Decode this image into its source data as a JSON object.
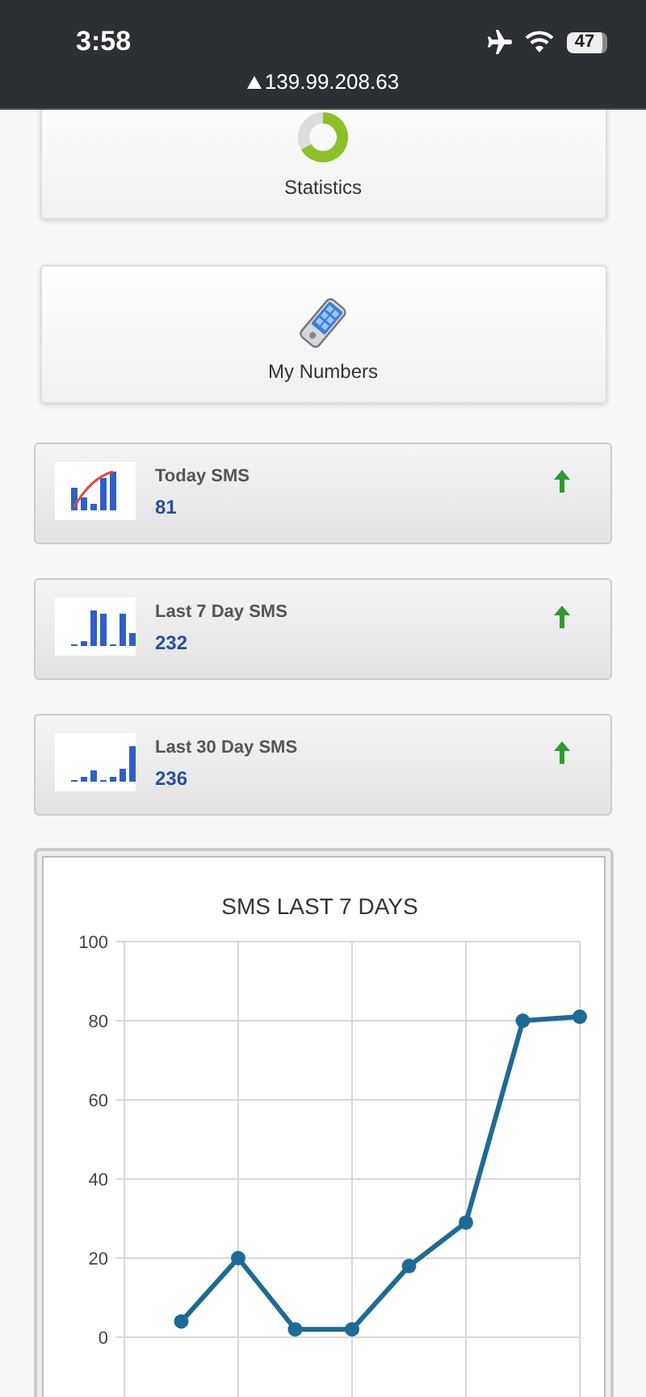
{
  "status_bar": {
    "time": "3:58",
    "battery": "47"
  },
  "address_bar": {
    "url": "139.99.208.63"
  },
  "nav_buttons": [
    {
      "kind": "statistics",
      "label": "Statistics"
    },
    {
      "kind": "numbers",
      "label": "My Numbers"
    }
  ],
  "sms_stats": [
    {
      "kind": "today",
      "title": "Today SMS",
      "count": "81",
      "rising": true
    },
    {
      "kind": "week",
      "title": "Last 7 Day SMS",
      "count": "232",
      "rising": true
    },
    {
      "kind": "month",
      "title": "Last 30 Day SMS",
      "count": "236",
      "rising": true
    }
  ],
  "chart": {
    "chart_data": {
      "type": "line",
      "title": "SMS LAST 7 DAYS",
      "categories": [
        null,
        null,
        null,
        null,
        null,
        null,
        null,
        null
      ],
      "ylim": [
        -20,
        100
      ],
      "grid": true,
      "yticks": [
        0,
        20,
        40,
        60,
        80,
        100
      ],
      "series": [
        {
          "color": "#1f6a94",
          "marker": "circle",
          "values": [
            4,
            20,
            2,
            2,
            18,
            29,
            80,
            81
          ]
        }
      ]
    }
  }
}
